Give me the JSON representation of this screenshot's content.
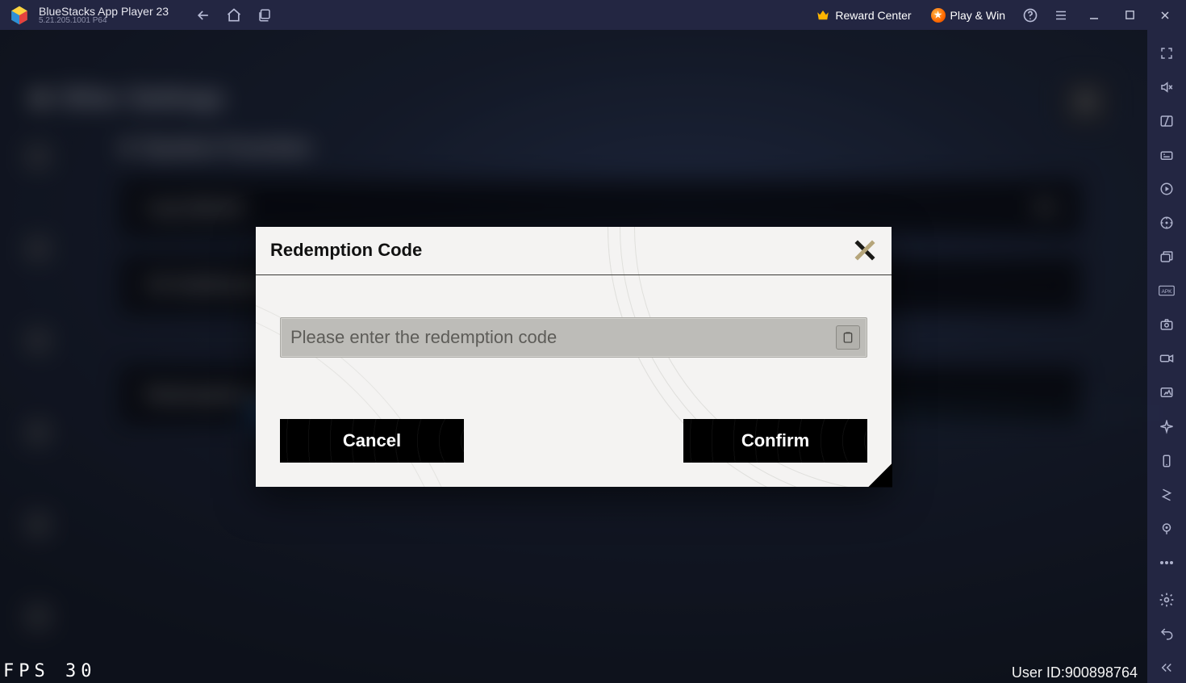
{
  "title_bar": {
    "app_name": "BlueStacks App Player 23",
    "version_line": "5.21.205.1001  P64",
    "reward_label": "Reward Center",
    "playwin_label": "Play & Win"
  },
  "bg": {
    "screen_title": "Other Settings",
    "section": "System Function",
    "row1_label": "Log Upload",
    "row1_action": "Go",
    "row2_label": "CG Notification",
    "accent_label": "Account",
    "row3_label": "Redemption Code",
    "close_glyph": "✕"
  },
  "modal": {
    "title": "Redemption Code",
    "placeholder": "Please enter the redemption code",
    "cancel": "Cancel",
    "confirm": "Confirm"
  },
  "overlay": {
    "fps_text": "FPS  30",
    "user_id_label": "User ID:",
    "user_id_value": "900898764"
  }
}
